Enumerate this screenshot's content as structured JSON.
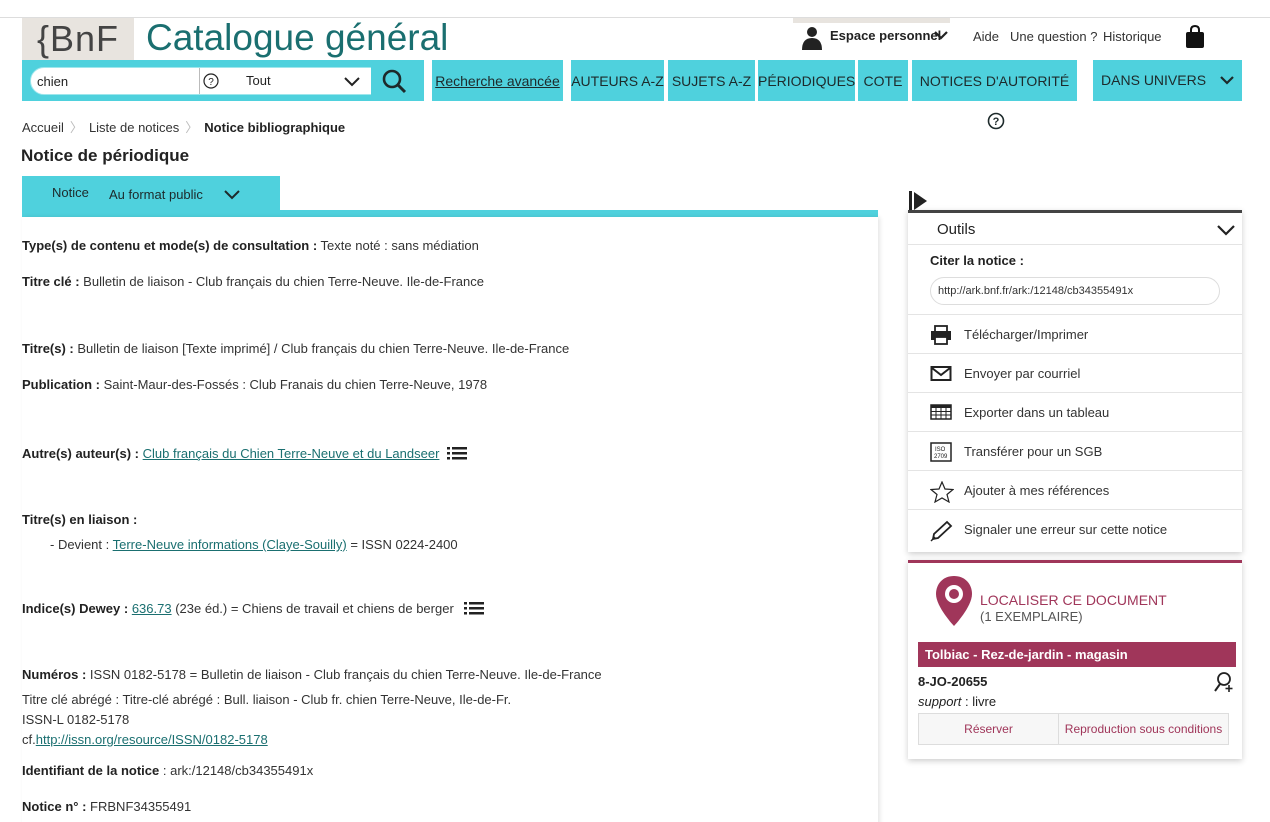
{
  "header": {
    "logo_text": "{BnF",
    "site_title": "Catalogue général",
    "espace_label": "Espace personnel",
    "links": [
      "Aide",
      "Une question ?",
      "Historique"
    ]
  },
  "search": {
    "query": "chien",
    "scope": "Tout"
  },
  "nav": {
    "advanced": "Recherche avancée",
    "items": [
      "AUTEURS A-Z",
      "SUJETS A-Z",
      "PÉRIODIQUES",
      "COTE",
      "NOTICES D'AUTORITÉ"
    ],
    "univers": "DANS UNIVERS"
  },
  "breadcrumb": [
    "Accueil",
    "Liste de notices",
    "Notice bibliographique"
  ],
  "page_title": "Notice de périodique",
  "tab": {
    "label": "Notice",
    "format": "Au format public"
  },
  "record": {
    "type_label": "Type(s) de contenu et mode(s) de consultation :",
    "type_value": " Texte noté : sans médiation",
    "titrecle_label": "Titre clé :",
    "titrecle_value": " Bulletin de liaison - Club français du chien Terre-Neuve. Ile-de-France",
    "titres_label": "Titre(s) :",
    "titres_value": " Bulletin de liaison [Texte imprimé] / Club français du chien Terre-Neuve. Ile-de-France",
    "publication_label": "Publication :",
    "publication_value": " Saint-Maur-des-Fossés : Club Franais du chien Terre-Neuve, 1978",
    "auteurs_label": "Autre(s) auteur(s) :",
    "auteurs_link": "Club français du Chien Terre-Neuve et du Landseer",
    "liaison_label": "Titre(s) en liaison :",
    "liaison_prefix": "- Devient : ",
    "liaison_link": "Terre-Neuve informations (Claye-Souilly)",
    "liaison_suffix": " = ISSN 0224-2400",
    "dewey_label": "Indice(s) Dewey :",
    "dewey_link": "636.73",
    "dewey_suffix": " (23e éd.) = Chiens de travail et chiens de berger",
    "numeros_label": "Numéros :",
    "numeros_value": " ISSN 0182-5178 = Bulletin de liaison - Club français du chien Terre-Neuve. Ile-de-France",
    "abrege": "Titre clé abrégé : Titre-clé abrégé : Bull. liaison - Club fr. chien Terre-Neuve, Ile-de-Fr.",
    "issnl": "ISSN-L 0182-5178",
    "cf_prefix": "cf.",
    "cf_link": "http://issn.org/resource/ISSN/0182-5178",
    "identifiant_label": "Identifiant de la notice",
    "identifiant_value": "  :  ark:/12148/cb34355491x",
    "noticeno_label": "Notice n° :",
    "noticeno_value": "  FRBNF34355491"
  },
  "outils": {
    "title": "Outils",
    "cite_label": "Citer la notice :",
    "cite_url": "http://ark.bnf.fr/ark:/12148/cb34355491x",
    "items": [
      {
        "label": "Télécharger/Imprimer",
        "icon": "printer-icon"
      },
      {
        "label": "Envoyer par courriel",
        "icon": "mail-icon"
      },
      {
        "label": "Exporter dans un tableau",
        "icon": "spreadsheet-icon"
      },
      {
        "label": "Transférer pour un SGB",
        "icon": "iso2709-icon"
      },
      {
        "label": "Ajouter à mes références",
        "icon": "star-icon"
      },
      {
        "label": "Signaler une erreur sur cette notice",
        "icon": "pencil-icon"
      }
    ]
  },
  "localisation": {
    "title": "LOCALISER CE DOCUMENT",
    "count": "(1 EXEMPLAIRE)",
    "site": "Tolbiac - Rez-de-jardin - magasin",
    "cote": "8-JO-20655",
    "support_label": "support",
    "support_value": " : livre",
    "reserve": "Réserver",
    "reproduction": "Reproduction sous conditions"
  },
  "colors": {
    "teal": "#4fd1dd",
    "brand": "#1a6f70",
    "plum": "#a0365a"
  }
}
